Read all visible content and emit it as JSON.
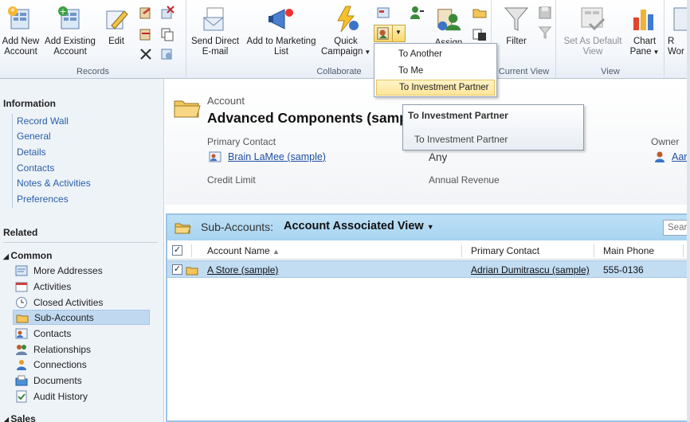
{
  "ribbon": {
    "records": {
      "label": "Records",
      "add_new": "Add New\nAccount",
      "add_existing": "Add Existing\nAccount",
      "edit": "Edit"
    },
    "collaborate": {
      "label": "Collaborate",
      "send_direct": "Send Direct\nE-mail",
      "add_marketing": "Add to Marketing\nList",
      "quick_campaign": "Quick\nCampaign",
      "assign": "Assign"
    },
    "current_view": {
      "label": "Current View",
      "filter": "Filter"
    },
    "view": {
      "label": "View",
      "set_default": "Set As Default\nView",
      "chart_pane": "Chart\nPane"
    },
    "workflow_partial": "R\nWor"
  },
  "menu": {
    "items": [
      "To Another",
      "To Me",
      "To Investment Partner"
    ]
  },
  "tooltip": {
    "title": "To Investment Partner",
    "body": "To Investment Partner"
  },
  "leftnav": {
    "information_title": "Information",
    "information_links": [
      "Record Wall",
      "General",
      "Details",
      "Contacts",
      "Notes & Activities",
      "Preferences"
    ],
    "related_title": "Related",
    "common_title": "Common",
    "common_items": [
      "More Addresses",
      "Activities",
      "Closed Activities",
      "Sub-Accounts",
      "Contacts",
      "Relationships",
      "Connections",
      "Documents",
      "Audit History"
    ],
    "sales_title": "Sales"
  },
  "form": {
    "entity": "Account",
    "name": "Advanced Components (samp",
    "primary_contact_label": "Primary Contact",
    "primary_contact_value": "Brain LaMee (sample)",
    "any_value": "Any",
    "owner_label": "Owner",
    "owner_value": "Aar",
    "credit_limit_label": "Credit Limit",
    "annual_revenue_label": "Annual Revenue"
  },
  "subgrid": {
    "prefix": "Sub-Accounts:",
    "view_name": "Account Associated View",
    "search_placeholder": "Searc",
    "columns": [
      "Account Name",
      "Primary Contact",
      "Main Phone"
    ],
    "rows": [
      {
        "name": "A Store (sample)",
        "contact": "Adrian Dumitrascu (sample)",
        "phone": "555-0136"
      }
    ]
  },
  "colors": {
    "link": "#2a5ea8",
    "selection": "#c1d9f0",
    "menu_highlight": "#fde59a",
    "grid_header": "#a8d4f1"
  }
}
